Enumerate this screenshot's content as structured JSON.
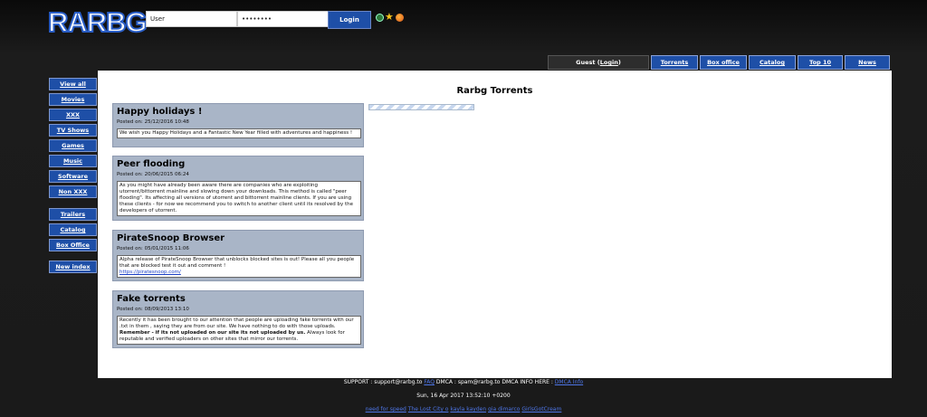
{
  "logo": {
    "text": "RARBG"
  },
  "login": {
    "user_value": "User",
    "pass_value": "••••••••",
    "button": "Login"
  },
  "tabs": {
    "guest_prefix": "Guest (",
    "guest_link": "Login",
    "guest_suffix": ")",
    "items": [
      "Torrents",
      "Box office",
      "Catalog",
      "Top 10",
      "News"
    ]
  },
  "sidebar": {
    "group1": [
      "View all",
      "Movies",
      "XXX",
      "TV Shows",
      "Games",
      "Music",
      "Software",
      "Non XXX"
    ],
    "group2": [
      "Trailers",
      "Catalog",
      "Box Office"
    ],
    "group3": [
      "New index"
    ]
  },
  "main": {
    "title": "Rarbg Torrents"
  },
  "news": [
    {
      "title": "Happy holidays !",
      "date": "Posted on: 25/12/2016 10:48",
      "body": "We wish you Happy Holidays and a Fantastic New Year filled with adventures and happiness !"
    },
    {
      "title": "Peer flooding",
      "date": "Posted on: 20/06/2015 06:24",
      "body": "As you might have already been aware there are companies who are exploiting utorrent/bittorrent mainline and slowing down your downloads. This method is called \"peer flooding\". Its affecting all versions of utorrent and bittorrent mainline clients. If you are using these clients - for now we recommend you to switch to another client until its resolved by the developers of utorrent."
    },
    {
      "title": "PirateSnoop Browser",
      "date": "Posted on: 05/01/2015 11:06",
      "body": "Alpha release of PirateSnoop Browser that unblocks blocked sites is out! Please all you people that are blocked test it out and comment !",
      "link": "https://piratesnoop.com/"
    },
    {
      "title": "Fake torrents",
      "date": "Posted on: 08/09/2013 13:10",
      "body_pre": "Recently it has been brought to our attention that people are uploading fake torrents with our .txt in them , saying they are from our site. We have nothing to do with those uploads. ",
      "body_bold": "Remember - if its not uploaded on our site its not uploaded by us.",
      "body_post": " Always look for reputable and verified uploaders on other sites that mirror our torrents."
    }
  ],
  "footer": {
    "support": "SUPPORT : support@rarbg.to",
    "faq": "FAQ",
    "dmca": "DMCA : spam@rarbg.to DMCA INFO HERE :",
    "dmca_link": "DMCA Info",
    "datetime": "Sun, 16 Apr 2017 13:52:10 +0200",
    "links": [
      "need for speed",
      "The Lost City o",
      "kayla kayden",
      "gia dimarco",
      "GirlsGotCream"
    ]
  }
}
